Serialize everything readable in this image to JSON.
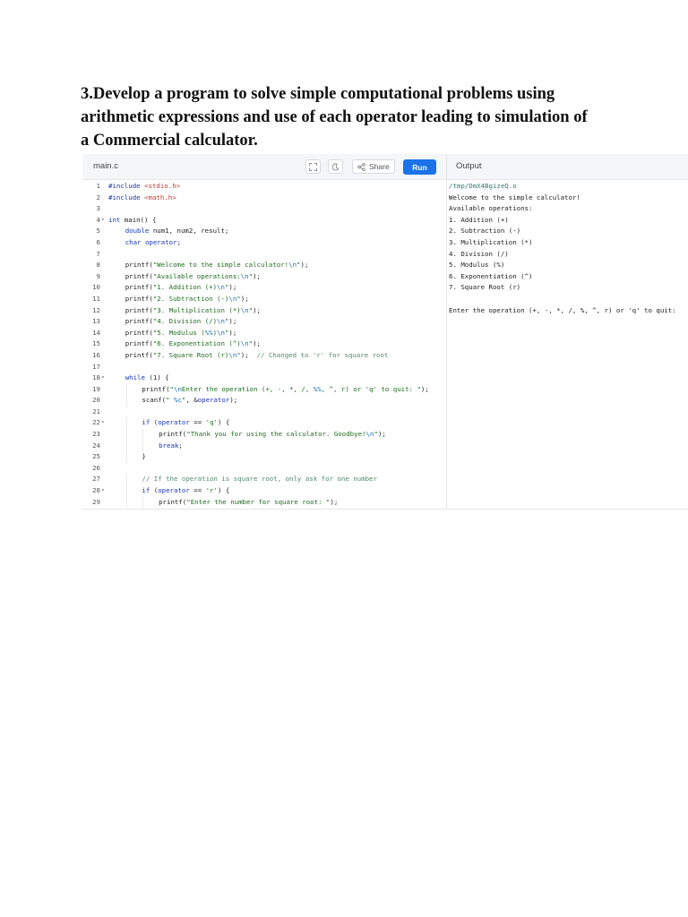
{
  "heading": {
    "line1": "3.Develop a program to solve simple computational problems using",
    "line2": "arithmetic expressions and use of each operator leading to simulation of",
    "line3": "a Commercial calculator."
  },
  "editor": {
    "filename": "main.c",
    "share_label": "Share",
    "run_label": "Run",
    "icons": [
      "fullscreen-icon",
      "theme-moon-icon",
      "share-icon"
    ]
  },
  "code_lines": [
    {
      "n": "1",
      "fold": "",
      "indent": 0,
      "tokens": [
        [
          "pp",
          "#include "
        ],
        [
          "inc",
          "<stdio.h>"
        ]
      ]
    },
    {
      "n": "2",
      "fold": "",
      "indent": 0,
      "tokens": [
        [
          "pp",
          "#include "
        ],
        [
          "inc",
          "<math.h>"
        ]
      ]
    },
    {
      "n": "3",
      "fold": "",
      "indent": 0,
      "tokens": []
    },
    {
      "n": "4",
      "fold": "▾",
      "indent": 0,
      "tokens": [
        [
          "kw",
          "int"
        ],
        [
          "",
          " main() {"
        ]
      ]
    },
    {
      "n": "5",
      "fold": "",
      "indent": 1,
      "tokens": [
        [
          "kw",
          "double"
        ],
        [
          "",
          " num1, num2, result;"
        ]
      ]
    },
    {
      "n": "6",
      "fold": "",
      "indent": 1,
      "tokens": [
        [
          "kw",
          "char"
        ],
        [
          "",
          " "
        ],
        [
          "kw",
          "operator"
        ],
        [
          "",
          ";"
        ]
      ]
    },
    {
      "n": "7",
      "fold": "",
      "indent": 0,
      "tokens": []
    },
    {
      "n": "8",
      "fold": "",
      "indent": 1,
      "tokens": [
        [
          "",
          "printf("
        ],
        [
          "str",
          "\"Welcome to the simple calculator!"
        ],
        [
          "esc",
          "\\n"
        ],
        [
          "str",
          "\""
        ],
        [
          "",
          ");"
        ]
      ]
    },
    {
      "n": "9",
      "fold": "",
      "indent": 1,
      "tokens": [
        [
          "",
          "printf("
        ],
        [
          "str",
          "\"Available operations:"
        ],
        [
          "esc",
          "\\n"
        ],
        [
          "str",
          "\""
        ],
        [
          "",
          ");"
        ]
      ]
    },
    {
      "n": "10",
      "fold": "",
      "indent": 1,
      "tokens": [
        [
          "",
          "printf("
        ],
        [
          "str",
          "\"1. Addition (+)"
        ],
        [
          "esc",
          "\\n"
        ],
        [
          "str",
          "\""
        ],
        [
          "",
          ");"
        ]
      ]
    },
    {
      "n": "11",
      "fold": "",
      "indent": 1,
      "tokens": [
        [
          "",
          "printf("
        ],
        [
          "str",
          "\"2. Subtraction (-)"
        ],
        [
          "esc",
          "\\n"
        ],
        [
          "str",
          "\""
        ],
        [
          "",
          ");"
        ]
      ]
    },
    {
      "n": "12",
      "fold": "",
      "indent": 1,
      "tokens": [
        [
          "",
          "printf("
        ],
        [
          "str",
          "\"3. Multiplication (*)"
        ],
        [
          "esc",
          "\\n"
        ],
        [
          "str",
          "\""
        ],
        [
          "",
          ");"
        ]
      ]
    },
    {
      "n": "13",
      "fold": "",
      "indent": 1,
      "tokens": [
        [
          "",
          "printf("
        ],
        [
          "str",
          "\"4. Division (/)"
        ],
        [
          "esc",
          "\\n"
        ],
        [
          "str",
          "\""
        ],
        [
          "",
          ");"
        ]
      ]
    },
    {
      "n": "14",
      "fold": "",
      "indent": 1,
      "tokens": [
        [
          "",
          "printf("
        ],
        [
          "str",
          "\"5. Modulus ("
        ],
        [
          "esc",
          "%%"
        ],
        [
          "str",
          ")"
        ],
        [
          "esc",
          "\\n"
        ],
        [
          "str",
          "\""
        ],
        [
          "",
          ");"
        ]
      ]
    },
    {
      "n": "15",
      "fold": "",
      "indent": 1,
      "tokens": [
        [
          "",
          "printf("
        ],
        [
          "str",
          "\"6. Exponentiation (^)"
        ],
        [
          "esc",
          "\\n"
        ],
        [
          "str",
          "\""
        ],
        [
          "",
          ");"
        ]
      ]
    },
    {
      "n": "16",
      "fold": "",
      "indent": 1,
      "tokens": [
        [
          "",
          "printf("
        ],
        [
          "str",
          "\"7. Square Root (r)"
        ],
        [
          "esc",
          "\\n"
        ],
        [
          "str",
          "\""
        ],
        [
          "",
          ");  "
        ],
        [
          "cm",
          "// Changed to 'r' for square root"
        ]
      ]
    },
    {
      "n": "17",
      "fold": "",
      "indent": 0,
      "tokens": []
    },
    {
      "n": "18",
      "fold": "▾",
      "indent": 1,
      "tokens": [
        [
          "kw",
          "while"
        ],
        [
          "",
          " (1) {"
        ]
      ]
    },
    {
      "n": "19",
      "fold": "",
      "indent": 2,
      "tokens": [
        [
          "",
          "printf("
        ],
        [
          "str",
          "\""
        ],
        [
          "esc",
          "\\n"
        ],
        [
          "str",
          "Enter the operation (+, -, *, /, "
        ],
        [
          "esc",
          "%%"
        ],
        [
          "str",
          ", ^, r) or 'q' to quit: \""
        ],
        [
          "",
          ");"
        ]
      ]
    },
    {
      "n": "20",
      "fold": "",
      "indent": 2,
      "tokens": [
        [
          "",
          "scanf("
        ],
        [
          "str",
          "\" "
        ],
        [
          "esc",
          "%c"
        ],
        [
          "str",
          "\""
        ],
        [
          "",
          ", &"
        ],
        [
          "op",
          "operator"
        ],
        [
          "",
          ");"
        ]
      ]
    },
    {
      "n": "21",
      "fold": "",
      "indent": 0,
      "tokens": []
    },
    {
      "n": "22",
      "fold": "▾",
      "indent": 2,
      "tokens": [
        [
          "kw",
          "if"
        ],
        [
          "",
          " ("
        ],
        [
          "op",
          "operator"
        ],
        [
          "",
          " == "
        ],
        [
          "str",
          "'q'"
        ],
        [
          "",
          ") {"
        ]
      ]
    },
    {
      "n": "23",
      "fold": "",
      "indent": 3,
      "tokens": [
        [
          "",
          "printf("
        ],
        [
          "str",
          "\"Thank you for using the calculator. Goodbye!"
        ],
        [
          "esc",
          "\\n"
        ],
        [
          "str",
          "\""
        ],
        [
          "",
          ");"
        ]
      ]
    },
    {
      "n": "24",
      "fold": "",
      "indent": 3,
      "tokens": [
        [
          "kw",
          "break"
        ],
        [
          "",
          ";"
        ]
      ]
    },
    {
      "n": "25",
      "fold": "",
      "indent": 2,
      "tokens": [
        [
          "",
          "}"
        ]
      ]
    },
    {
      "n": "26",
      "fold": "",
      "indent": 0,
      "tokens": []
    },
    {
      "n": "27",
      "fold": "",
      "indent": 2,
      "tokens": [
        [
          "cm",
          "// If the operation is square root, only ask for one number"
        ]
      ]
    },
    {
      "n": "28",
      "fold": "▾",
      "indent": 2,
      "tokens": [
        [
          "kw",
          "if"
        ],
        [
          "",
          " ("
        ],
        [
          "op",
          "operator"
        ],
        [
          "",
          " == "
        ],
        [
          "str",
          "'r'"
        ],
        [
          "",
          ") {"
        ]
      ]
    },
    {
      "n": "29",
      "fold": "",
      "indent": 3,
      "tokens": [
        [
          "",
          "printf("
        ],
        [
          "str",
          "\"Enter the number for square root: \""
        ],
        [
          "",
          ");"
        ]
      ]
    }
  ],
  "output": {
    "title": "Output",
    "lines": [
      "/tmp/DmX4BgizeQ.o",
      "Welcome to the simple calculator!",
      "Available operations:",
      "1. Addition (+)",
      "2. Subtraction (-)",
      "3. Multiplication (*)",
      "4. Division (/)",
      "5. Modulus (%)",
      "6. Exponentiation (^)",
      "7. Square Root (r)",
      "",
      "Enter the operation (+, -, *, /, %, ^, r) or 'q' to quit:"
    ]
  }
}
